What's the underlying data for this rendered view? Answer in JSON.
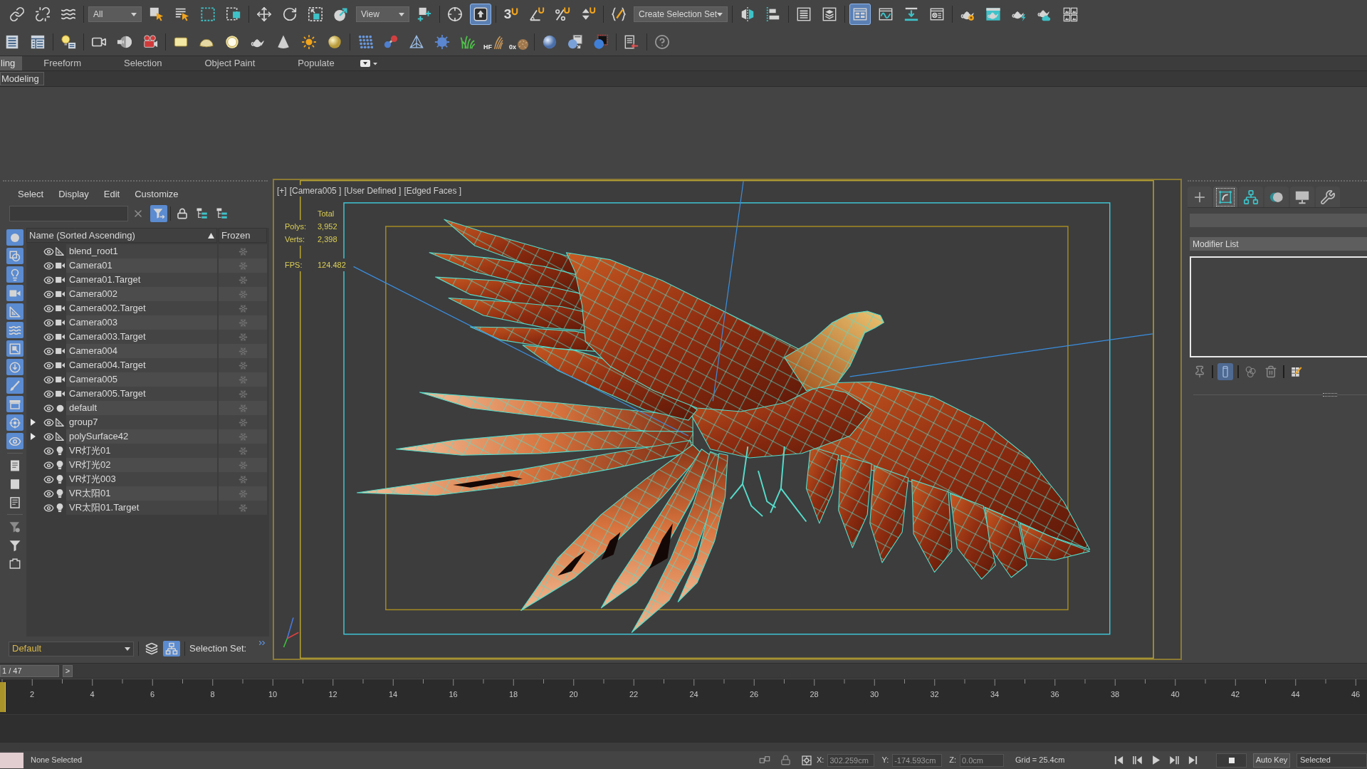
{
  "main_toolbar": [
    {
      "kind": "button",
      "on": false
    },
    {
      "kind": "button",
      "on": false
    },
    {
      "kind": "button",
      "on": false
    },
    {
      "kind": "dropdown",
      "value": "All"
    },
    {
      "kind": "button",
      "on": false
    },
    {
      "kind": "button",
      "on": false
    },
    {
      "kind": "button",
      "on": false
    },
    {
      "kind": "button",
      "on": false
    },
    {
      "kind": "button",
      "on": false
    },
    {
      "kind": "button",
      "on": false
    },
    {
      "kind": "button",
      "on": false
    },
    {
      "kind": "button",
      "on": false
    },
    {
      "kind": "dropdown",
      "value": "View"
    },
    {
      "kind": "button",
      "on": false
    },
    {
      "kind": "button",
      "on": false
    },
    {
      "kind": "button",
      "on": true
    },
    {
      "kind": "button",
      "on": false,
      "label": "3"
    },
    {
      "kind": "button",
      "on": false
    },
    {
      "kind": "button",
      "on": false
    },
    {
      "kind": "button",
      "on": false
    },
    {
      "kind": "button",
      "on": false
    },
    {
      "kind": "dropdown",
      "value": "Create Selection Set"
    },
    {
      "kind": "button",
      "on": false
    },
    {
      "kind": "button",
      "on": false
    },
    {
      "kind": "button",
      "on": false
    },
    {
      "kind": "button",
      "on": false
    },
    {
      "kind": "button",
      "on": true
    },
    {
      "kind": "button",
      "on": false
    },
    {
      "kind": "button",
      "on": false
    },
    {
      "kind": "button",
      "on": false
    },
    {
      "kind": "button",
      "on": false
    },
    {
      "kind": "button",
      "on": false
    },
    {
      "kind": "button",
      "on": false
    },
    {
      "kind": "button",
      "on": false
    },
    {
      "kind": "button",
      "on": false
    }
  ],
  "command_toolbar": {
    "hair_label": "HF",
    "fur_label": "0x"
  },
  "ribbon": {
    "tabs": [
      {
        "label": "ling",
        "selected": true
      },
      {
        "label": "Freeform",
        "selected": false
      },
      {
        "label": "Selection",
        "selected": false
      },
      {
        "label": "Object Paint",
        "selected": false
      },
      {
        "label": "Populate",
        "selected": false
      }
    ],
    "panel_tab": "Modeling"
  },
  "scene_explorer": {
    "menu": [
      "Select",
      "Display",
      "Edit",
      "Customize"
    ],
    "toolbar": [
      {
        "on": true
      },
      {
        "on": false
      },
      {
        "on": false
      },
      {
        "on": false
      }
    ],
    "filters": [
      {
        "on": true
      },
      {
        "on": true
      },
      {
        "on": true
      },
      {
        "on": true
      },
      {
        "on": true
      },
      {
        "on": true
      },
      {
        "on": true
      },
      {
        "on": true
      },
      {
        "on": true
      },
      {
        "on": true
      },
      {
        "on": true
      },
      {
        "on": true
      },
      {
        "on": false
      },
      {
        "on": false
      },
      {
        "on": false
      },
      {
        "on": false
      },
      {
        "on": false
      },
      {
        "on": false
      }
    ],
    "columns": [
      {
        "label": "Name (Sorted Ascending)",
        "sorted": true
      },
      {
        "label": "Frozen",
        "sorted": false
      }
    ],
    "rows": [
      {
        "name": "blend_root1",
        "kind": "helper",
        "visible": true,
        "frozen": false
      },
      {
        "name": "Camera01",
        "kind": "camera",
        "visible": true,
        "frozen": false
      },
      {
        "name": "Camera01.Target",
        "kind": "camera",
        "visible": true,
        "frozen": false
      },
      {
        "name": "Camera002",
        "kind": "camera",
        "visible": true,
        "frozen": false
      },
      {
        "name": "Camera002.Target",
        "kind": "camera",
        "visible": true,
        "frozen": false
      },
      {
        "name": "Camera003",
        "kind": "camera",
        "visible": true,
        "frozen": false
      },
      {
        "name": "Camera003.Target",
        "kind": "camera",
        "visible": true,
        "frozen": false
      },
      {
        "name": "Camera004",
        "kind": "camera",
        "visible": true,
        "frozen": false
      },
      {
        "name": "Camera004.Target",
        "kind": "camera",
        "visible": true,
        "frozen": false
      },
      {
        "name": "Camera005",
        "kind": "camera",
        "visible": true,
        "frozen": false
      },
      {
        "name": "Camera005.Target",
        "kind": "camera",
        "visible": true,
        "frozen": false
      },
      {
        "name": "default",
        "kind": "geometry",
        "visible": true,
        "frozen": false
      },
      {
        "name": "group7",
        "kind": "helper",
        "visible": true,
        "frozen": false,
        "expanded": false
      },
      {
        "name": "polySurface42",
        "kind": "helper",
        "visible": true,
        "frozen": false,
        "expanded": false
      },
      {
        "name": "VR灯光01",
        "kind": "light",
        "visible": true,
        "frozen": false
      },
      {
        "name": "VR灯光02",
        "kind": "light",
        "visible": true,
        "frozen": false
      },
      {
        "name": "VR灯光003",
        "kind": "light",
        "visible": true,
        "frozen": false
      },
      {
        "name": "VR太阳01",
        "kind": "light",
        "visible": true,
        "frozen": false
      },
      {
        "name": "VR太阳01.Target",
        "kind": "light",
        "visible": true,
        "frozen": false
      }
    ]
  },
  "layer_bar": {
    "layer": "Default",
    "buttons": [
      {
        "on": false
      },
      {
        "on": true
      }
    ],
    "selection_set_label": "Selection Set:"
  },
  "viewport": {
    "labels": [
      "[+]",
      "[Camera005 ]",
      "[User Defined ]",
      "[Edged Faces ]"
    ],
    "stats": {
      "header": "Total",
      "rows": [
        {
          "label": "Polys:",
          "value": "3,952"
        },
        {
          "label": "Verts:",
          "value": "2,398"
        }
      ],
      "fps": {
        "label": "FPS:",
        "value": "124.482"
      }
    }
  },
  "command_panel": {
    "tabs": [
      {
        "selected": false
      },
      {
        "selected": true
      },
      {
        "selected": false
      },
      {
        "selected": false
      },
      {
        "selected": false
      },
      {
        "selected": false
      }
    ],
    "modifier_list": "Modifier List",
    "stack_buttons": [
      {
        "on": false
      },
      {
        "on": true
      },
      {
        "on": false
      },
      {
        "on": false
      },
      {
        "on": false
      }
    ]
  },
  "time_slider": {
    "position": "1 / 47",
    "level": 0,
    "next": ">"
  },
  "track_bar": {
    "frame_labels": [
      "2",
      "4",
      "6",
      "8",
      "10",
      "12",
      "14",
      "16",
      "18",
      "20",
      "22",
      "24",
      "26",
      "28",
      "30",
      "32",
      "34",
      "36",
      "38",
      "40",
      "42",
      "44",
      "46"
    ]
  },
  "status_bar": {
    "selection": "None Selected",
    "coords": [
      {
        "label": "X:",
        "value": "302.259cm"
      },
      {
        "label": "Y:",
        "value": "-174.593cm"
      },
      {
        "label": "Z:",
        "value": "0.0cm"
      }
    ],
    "grid": "Grid = 25.4cm",
    "auto_key": "Auto Key",
    "key_filter": "Selected"
  }
}
